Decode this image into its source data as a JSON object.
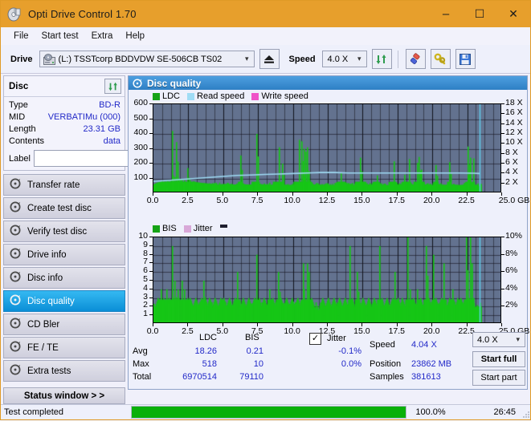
{
  "window": {
    "title": "Opti Drive Control 1.70",
    "icon": "disc-icon",
    "minimize": "–",
    "maximize": "☐",
    "close": "✕"
  },
  "menu": {
    "items": [
      "File",
      "Start test",
      "Extra",
      "Help"
    ]
  },
  "toolbar": {
    "drive_label": "Drive",
    "drive_value": "(L:)  TSSTcorp BDDVDW SE-506CB TS02",
    "eject_icon": "eject-icon",
    "speed_label": "Speed",
    "speed_value": "4.0 X",
    "refresh_icon": "refresh-icon",
    "erase_icon": "eraser-icon",
    "tools_icon": "wrench-icon",
    "save_icon": "floppy-disk-icon"
  },
  "sidebar": {
    "disc": {
      "title": "Disc",
      "refresh_icon": "refresh-icon",
      "rows": [
        {
          "key": "Type",
          "value": "BD-R"
        },
        {
          "key": "MID",
          "value": "VERBATIMu (000)"
        },
        {
          "key": "Length",
          "value": "23.31 GB"
        },
        {
          "key": "Contents",
          "value": "data"
        }
      ],
      "label_key": "Label",
      "label_value": "",
      "label_placeholder": "",
      "disc_icon": "cd-disc-icon"
    },
    "nav": [
      {
        "label": "Transfer rate",
        "icon": "disc-icon",
        "selected": false
      },
      {
        "label": "Create test disc",
        "icon": "disc-icon",
        "selected": false
      },
      {
        "label": "Verify test disc",
        "icon": "disc-icon",
        "selected": false
      },
      {
        "label": "Drive info",
        "icon": "disc-icon",
        "selected": false
      },
      {
        "label": "Disc info",
        "icon": "disc-icon",
        "selected": false
      },
      {
        "label": "Disc quality",
        "icon": "disc-icon",
        "selected": true
      },
      {
        "label": "CD Bler",
        "icon": "disc-icon",
        "selected": false
      },
      {
        "label": "FE / TE",
        "icon": "disc-icon",
        "selected": false
      },
      {
        "label": "Extra tests",
        "icon": "disc-icon",
        "selected": false
      }
    ],
    "status_window_button": "Status window > >"
  },
  "panel": {
    "title": "Disc quality",
    "icon": "disc-icon"
  },
  "stats": {
    "col_headers": [
      "LDC",
      "BIS"
    ],
    "row_headers": [
      "Avg",
      "Max",
      "Total"
    ],
    "ldc": {
      "avg": "18.26",
      "max": "518",
      "total": "6970514"
    },
    "bis": {
      "avg": "0.21",
      "max": "10",
      "total": "79110"
    },
    "jitter": {
      "label": "Jitter",
      "checked": true,
      "check_glyph": "✓",
      "avg": "-0.1%",
      "max": "0.0%"
    },
    "speed_label": "Speed",
    "speed_value": "4.04 X",
    "position_label": "Position",
    "position_value": "23862 MB",
    "samples_label": "Samples",
    "samples_value": "381613",
    "speed_select": "4.0 X",
    "start_full": "Start full",
    "start_part": "Start part"
  },
  "statusbar": {
    "text": "Test completed",
    "progress_percent": 100.0,
    "progress_label": "100.0%",
    "elapsed": "26:45"
  },
  "colors": {
    "titlebar": "#e79f2c",
    "accent_blue": "#2229c8",
    "plot_bg": "#63728f",
    "ldc_green": "#16c616",
    "read_speed": "#9fdcf5",
    "write_speed": "#ef54c8",
    "jitter_pink": "#d8a8d8",
    "progress_green": "#09b009",
    "selected_nav": "#0a8ed6"
  },
  "chart_data": [
    {
      "type": "line",
      "name": "disc-quality-ldc",
      "title": "",
      "xlabel": "GB",
      "ylabel": "",
      "xlim": [
        0,
        25
      ],
      "ylim": [
        0,
        600
      ],
      "y2lim": [
        0,
        18
      ],
      "y2label": "X",
      "xticks": [
        0.0,
        2.5,
        5.0,
        7.5,
        10.0,
        12.5,
        15.0,
        17.5,
        20.0,
        22.5,
        25.0
      ],
      "xticklabels": [
        "0.0",
        "2.5",
        "5.0",
        "7.5",
        "10.0",
        "12.5",
        "15.0",
        "17.5",
        "20.0",
        "22.5",
        "25.0 GB"
      ],
      "yticks": [
        100,
        200,
        300,
        400,
        500,
        600
      ],
      "y2ticks": [
        2,
        4,
        6,
        8,
        10,
        12,
        14,
        16,
        18
      ],
      "y2ticklabels": [
        "2 X",
        "4 X",
        "6 X",
        "8 X",
        "10 X",
        "12 X",
        "14 X",
        "16 X",
        "18 X"
      ],
      "grid": true,
      "legend": [
        {
          "name": "LDC",
          "color": "#16c616"
        },
        {
          "name": "Read speed",
          "color": "#9fdcf5"
        },
        {
          "name": "Write speed",
          "color": "#ef54c8"
        }
      ],
      "series": [
        {
          "name": "LDC",
          "color": "#16c616",
          "style": "filled-spikes",
          "x": [
            0.0,
            0.2,
            0.4,
            0.6,
            0.8,
            1.0,
            1.2,
            1.3,
            1.4,
            1.5,
            1.6,
            1.8,
            1.9,
            2.0,
            2.2,
            2.4,
            2.6,
            2.8,
            2.9,
            3.0,
            3.2,
            3.4,
            3.6,
            3.8,
            4.0,
            4.2,
            4.4,
            4.6,
            4.8,
            5.0,
            5.5,
            6.0,
            6.2,
            6.3,
            6.5,
            7.0,
            7.4,
            7.55,
            7.7,
            8.0,
            8.5,
            9.0,
            9.2,
            9.3,
            9.4,
            9.6,
            10.0,
            10.4,
            10.6,
            10.7,
            10.8,
            10.9,
            11.0,
            11.1,
            11.2,
            11.4,
            11.8,
            12.2,
            12.6,
            13.0,
            13.4,
            13.8,
            14.0,
            14.1,
            14.2,
            14.4,
            14.8,
            15.2,
            15.6,
            16.0,
            16.2,
            16.3,
            16.5,
            16.8,
            17.2,
            17.4,
            17.5,
            17.7,
            18.0,
            18.3,
            18.4,
            18.6,
            18.9,
            19.0,
            19.2,
            19.4,
            19.6,
            19.8,
            19.9,
            20.0,
            20.2,
            20.4,
            20.6,
            21.0,
            21.2,
            21.3,
            21.5,
            21.8,
            22.0,
            22.3,
            22.5,
            22.6,
            22.7,
            22.8,
            22.9,
            23.0,
            23.2,
            23.4
          ],
          "y": [
            60,
            70,
            75,
            80,
            78,
            85,
            90,
            420,
            120,
            110,
            345,
            100,
            95,
            90,
            88,
            170,
            85,
            80,
            78,
            75,
            72,
            70,
            68,
            66,
            64,
            62,
            60,
            58,
            60,
            62,
            60,
            58,
            255,
            70,
            60,
            58,
            400,
            65,
            60,
            58,
            56,
            310,
            200,
            60,
            58,
            56,
            55,
            360,
            350,
            180,
            300,
            280,
            310,
            150,
            90,
            60,
            58,
            56,
            55,
            54,
            140,
            60,
            58,
            56,
            55,
            54,
            240,
            60,
            58,
            120,
            58,
            56,
            55,
            54,
            215,
            60,
            58,
            56,
            125,
            230,
            60,
            58,
            205,
            245,
            160,
            60,
            58,
            56,
            55,
            54,
            190,
            60,
            58,
            56,
            210,
            60,
            58,
            56,
            55,
            60,
            315,
            120,
            240,
            60,
            235,
            58,
            56,
            40
          ]
        },
        {
          "name": "Read speed",
          "color": "#9fdcf5",
          "style": "line",
          "axis": "y2",
          "x": [
            0.0,
            1.0,
            2.0,
            3.0,
            4.0,
            5.0,
            6.0,
            7.0,
            8.0,
            9.0,
            10.0,
            11.0,
            12.0,
            13.0,
            14.0,
            15.0,
            16.0,
            17.0,
            18.0,
            19.0,
            20.0,
            21.0,
            22.0,
            23.0,
            23.4
          ],
          "y": [
            2.4,
            2.6,
            2.8,
            3.0,
            3.2,
            3.4,
            3.6,
            3.7,
            3.8,
            3.9,
            4.0,
            4.1,
            4.2,
            4.2,
            4.1,
            4.1,
            4.1,
            4.1,
            4.1,
            4.1,
            4.1,
            4.1,
            4.1,
            4.05,
            4.0
          ]
        }
      ],
      "marker_line": {
        "x": 23.4,
        "color": "#5fd0f0"
      }
    },
    {
      "type": "bar",
      "name": "disc-quality-bis",
      "title": "",
      "xlabel": "GB",
      "ylabel": "",
      "xlim": [
        0,
        25
      ],
      "ylim": [
        0,
        10
      ],
      "y2lim": [
        0,
        10
      ],
      "y2label": "%",
      "xticks": [
        0.0,
        2.5,
        5.0,
        7.5,
        10.0,
        12.5,
        15.0,
        17.5,
        20.0,
        22.5,
        25.0
      ],
      "xticklabels": [
        "0.0",
        "2.5",
        "5.0",
        "7.5",
        "10.0",
        "12.5",
        "15.0",
        "17.5",
        "20.0",
        "22.5",
        "25.0 GB"
      ],
      "yticks": [
        1,
        2,
        3,
        4,
        5,
        6,
        7,
        8,
        9,
        10
      ],
      "y2ticks": [
        2,
        4,
        6,
        8,
        10
      ],
      "y2ticklabels": [
        "2%",
        "4%",
        "6%",
        "8%",
        "10%"
      ],
      "grid": true,
      "legend": [
        {
          "name": "BIS",
          "color": "#16c616"
        },
        {
          "name": "Jitter",
          "color": "#d8a8d8"
        }
      ],
      "series": [
        {
          "name": "BIS",
          "color": "#16c616",
          "style": "filled-spikes",
          "x": [
            0.1,
            0.3,
            0.5,
            0.7,
            0.9,
            1.1,
            1.3,
            1.4,
            1.5,
            1.7,
            1.8,
            2.0,
            2.2,
            2.4,
            2.6,
            2.8,
            3.0,
            3.2,
            3.4,
            3.6,
            3.8,
            4.0,
            4.2,
            4.4,
            4.6,
            4.8,
            5.0,
            5.2,
            5.4,
            5.6,
            5.8,
            6.0,
            6.2,
            6.4,
            6.6,
            6.8,
            7.0,
            7.2,
            7.4,
            7.55,
            7.7,
            7.9,
            8.1,
            8.3,
            8.5,
            8.7,
            8.9,
            9.1,
            9.3,
            9.5,
            9.7,
            9.9,
            10.1,
            10.3,
            10.5,
            10.7,
            10.8,
            11.0,
            11.1,
            11.3,
            11.5,
            11.7,
            11.9,
            12.1,
            12.3,
            12.5,
            12.7,
            12.9,
            13.1,
            13.3,
            13.5,
            13.7,
            13.9,
            14.05,
            14.2,
            14.4,
            14.6,
            14.8,
            15.0,
            15.2,
            15.4,
            15.6,
            15.8,
            16.0,
            16.2,
            16.35,
            16.5,
            16.7,
            16.9,
            17.1,
            17.3,
            17.5,
            17.65,
            17.8,
            18.0,
            18.2,
            18.4,
            18.6,
            18.8,
            18.9,
            19.1,
            19.3,
            19.5,
            19.7,
            19.9,
            20.05,
            20.2,
            20.4,
            20.6,
            20.8,
            21.0,
            21.2,
            21.4,
            21.6,
            21.8,
            22.0,
            22.2,
            22.4,
            22.6,
            22.7,
            22.8,
            22.9,
            23.0,
            23.2,
            23.35
          ],
          "y": [
            2,
            3,
            4,
            3,
            4,
            3,
            9,
            3,
            5,
            4,
            3,
            5,
            4,
            3,
            3,
            2,
            3,
            2,
            3,
            5,
            2,
            3,
            2,
            3,
            2,
            3,
            3,
            2,
            3,
            2,
            3,
            6,
            2,
            3,
            2,
            3,
            2,
            3,
            8,
            3,
            2,
            3,
            2,
            4,
            3,
            2,
            6,
            3,
            2,
            3,
            2,
            3,
            2,
            3,
            2,
            7,
            4,
            7,
            6,
            3,
            2,
            1,
            2,
            3,
            2,
            3,
            2,
            3,
            2,
            3,
            2,
            3,
            2,
            9,
            3,
            2,
            6,
            2,
            3,
            2,
            3,
            2,
            3,
            2,
            9,
            3,
            2,
            3,
            2,
            3,
            6,
            3,
            2,
            3,
            2,
            10,
            4,
            3,
            2,
            4,
            3,
            2,
            9,
            3,
            2,
            8,
            3,
            2,
            3,
            7,
            2,
            3,
            4,
            2,
            3,
            3,
            2,
            10,
            3,
            10,
            7,
            3,
            2,
            2,
            2
          ]
        }
      ],
      "marker_line": {
        "x": 23.4,
        "color": "#5fd0f0"
      }
    }
  ]
}
